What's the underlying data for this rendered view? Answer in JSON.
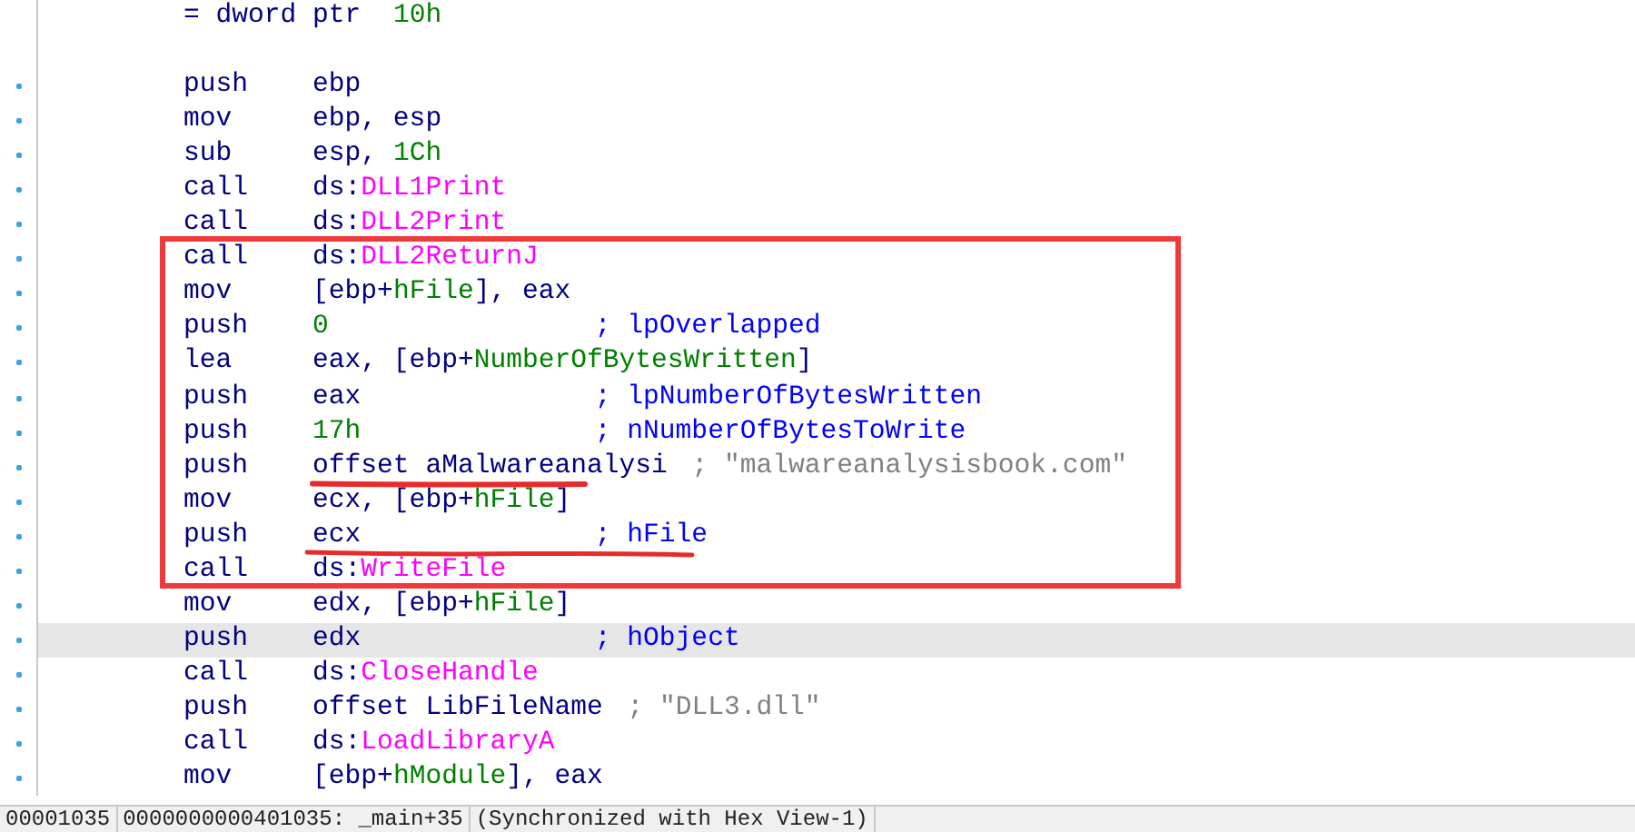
{
  "lines": [
    {
      "kind": "directive",
      "dot": false,
      "selected": false,
      "parts": [
        {
          "text": "= dword ptr  ",
          "kind": "plain"
        },
        {
          "text": "10h",
          "kind": "number"
        }
      ]
    },
    {
      "kind": "blank",
      "dot": false,
      "selected": false
    },
    {
      "kind": "instruction",
      "dot": true,
      "selected": false,
      "mnemonic": "push",
      "operand": [
        {
          "text": "ebp",
          "kind": "plain"
        }
      ]
    },
    {
      "kind": "instruction",
      "dot": true,
      "selected": false,
      "mnemonic": "mov",
      "operand": [
        {
          "text": "ebp, esp",
          "kind": "plain"
        }
      ]
    },
    {
      "kind": "instruction",
      "dot": true,
      "selected": false,
      "mnemonic": "sub",
      "operand": [
        {
          "text": "esp, ",
          "kind": "plain"
        },
        {
          "text": "1Ch",
          "kind": "number"
        }
      ]
    },
    {
      "kind": "instruction",
      "dot": true,
      "selected": false,
      "mnemonic": "call",
      "operand": [
        {
          "text": "ds:",
          "kind": "plain"
        },
        {
          "text": "DLL1Print",
          "kind": "import"
        }
      ]
    },
    {
      "kind": "instruction",
      "dot": true,
      "selected": false,
      "mnemonic": "call",
      "operand": [
        {
          "text": "ds:",
          "kind": "plain"
        },
        {
          "text": "DLL2Print",
          "kind": "import"
        }
      ]
    },
    {
      "kind": "instruction",
      "dot": true,
      "selected": false,
      "mnemonic": "call",
      "operand": [
        {
          "text": "ds:",
          "kind": "plain"
        },
        {
          "text": "DLL2ReturnJ",
          "kind": "import"
        }
      ]
    },
    {
      "kind": "instruction",
      "dot": true,
      "selected": false,
      "mnemonic": "mov",
      "operand": [
        {
          "text": "[ebp+",
          "kind": "plain"
        },
        {
          "text": "hFile",
          "kind": "var"
        },
        {
          "text": "], eax",
          "kind": "plain"
        }
      ]
    },
    {
      "kind": "instruction",
      "dot": true,
      "selected": false,
      "mnemonic": "push",
      "operand": [
        {
          "text": "0",
          "kind": "number"
        }
      ],
      "comment": {
        "text": "; lpOverlapped",
        "kind": "comment"
      }
    },
    {
      "kind": "instruction",
      "dot": true,
      "selected": false,
      "mnemonic": "lea",
      "operand": [
        {
          "text": "eax, [ebp+",
          "kind": "plain"
        },
        {
          "text": "NumberOfBytesWritten",
          "kind": "var"
        },
        {
          "text": "]",
          "kind": "plain"
        }
      ]
    },
    {
      "kind": "instruction",
      "dot": true,
      "selected": false,
      "mnemonic": "push",
      "operand": [
        {
          "text": "eax",
          "kind": "plain"
        }
      ],
      "comment": {
        "text": "; lpNumberOfBytesWritten",
        "kind": "comment"
      }
    },
    {
      "kind": "instruction",
      "dot": true,
      "selected": false,
      "mnemonic": "push",
      "operand": [
        {
          "text": "17h",
          "kind": "number"
        }
      ],
      "comment": {
        "text": "; nNumberOfBytesToWrite",
        "kind": "comment"
      }
    },
    {
      "kind": "instruction",
      "dot": true,
      "selected": false,
      "mnemonic": "push",
      "operand": [
        {
          "text": "offset aMalwareanalysi",
          "kind": "plain"
        }
      ],
      "comment": {
        "text": "; \"malwareanalysisbook.com\"",
        "kind": "string"
      }
    },
    {
      "kind": "instruction",
      "dot": true,
      "selected": false,
      "mnemonic": "mov",
      "operand": [
        {
          "text": "ecx, [ebp+",
          "kind": "plain"
        },
        {
          "text": "hFile",
          "kind": "var"
        },
        {
          "text": "]",
          "kind": "plain"
        }
      ]
    },
    {
      "kind": "instruction",
      "dot": true,
      "selected": false,
      "mnemonic": "push",
      "operand": [
        {
          "text": "ecx",
          "kind": "plain"
        }
      ],
      "comment": {
        "text": "; hFile",
        "kind": "comment"
      }
    },
    {
      "kind": "instruction",
      "dot": true,
      "selected": false,
      "mnemonic": "call",
      "operand": [
        {
          "text": "ds:",
          "kind": "plain"
        },
        {
          "text": "WriteFile",
          "kind": "import"
        }
      ]
    },
    {
      "kind": "instruction",
      "dot": true,
      "selected": false,
      "mnemonic": "mov",
      "operand": [
        {
          "text": "edx, [ebp+",
          "kind": "plain"
        },
        {
          "text": "hFile",
          "kind": "var"
        },
        {
          "text": "]",
          "kind": "plain"
        }
      ]
    },
    {
      "kind": "instruction",
      "dot": true,
      "selected": true,
      "mnemonic": "push",
      "operand": [
        {
          "text": "edx",
          "kind": "plain"
        }
      ],
      "comment": {
        "text": "; hObject",
        "kind": "comment"
      }
    },
    {
      "kind": "instruction",
      "dot": true,
      "selected": false,
      "mnemonic": "call",
      "operand": [
        {
          "text": "ds:",
          "kind": "plain"
        },
        {
          "text": "CloseHandle",
          "kind": "import"
        }
      ]
    },
    {
      "kind": "instruction",
      "dot": true,
      "selected": false,
      "mnemonic": "push",
      "operand": [
        {
          "text": "offset LibFileName",
          "kind": "plain"
        }
      ],
      "comment": {
        "text": "; \"DLL3.dll\"",
        "kind": "string"
      }
    },
    {
      "kind": "instruction",
      "dot": true,
      "selected": false,
      "mnemonic": "call",
      "operand": [
        {
          "text": "ds:",
          "kind": "plain"
        },
        {
          "text": "LoadLibraryA",
          "kind": "import"
        }
      ]
    },
    {
      "kind": "instruction",
      "dot": true,
      "selected": false,
      "mnemonic": "mov",
      "operand": [
        {
          "text": "[ebp+",
          "kind": "plain"
        },
        {
          "text": "hModule",
          "kind": "var"
        },
        {
          "text": "], eax",
          "kind": "plain"
        }
      ]
    }
  ],
  "status_bar": [
    "00001035",
    "0000000000401035: _main+35",
    "(Synchronized with Hex View-1)"
  ]
}
